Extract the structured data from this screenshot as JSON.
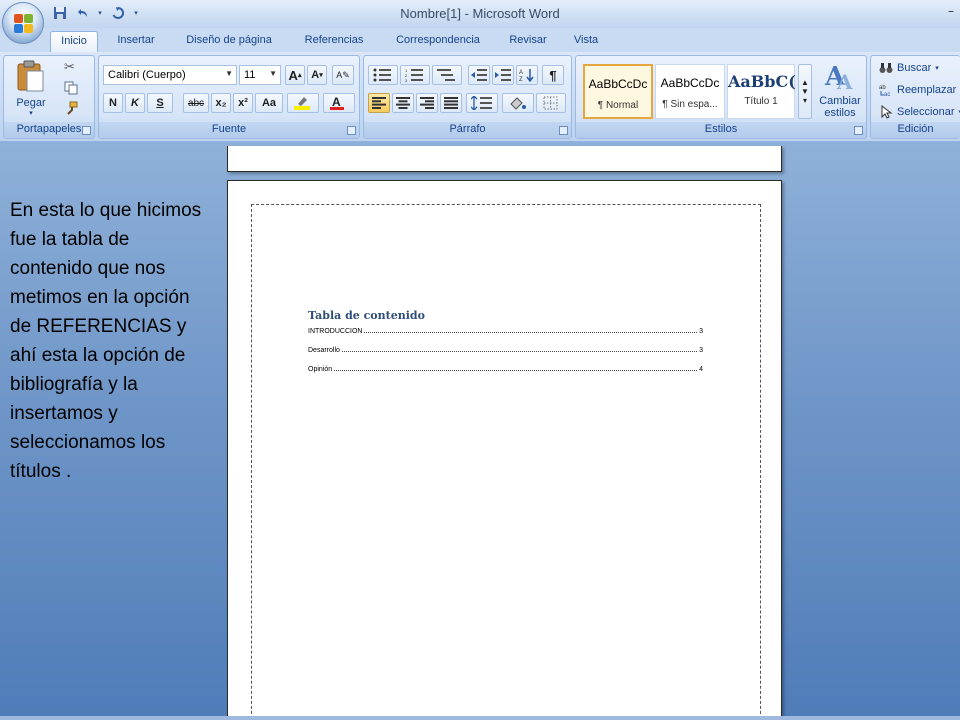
{
  "window": {
    "title": "Nombre[1] - Microsoft Word"
  },
  "tabs": [
    "Inicio",
    "Insertar",
    "Diseño de página",
    "Referencias",
    "Correspondencia",
    "Revisar",
    "Vista"
  ],
  "groups": {
    "clipboard": {
      "label": "Portapapeles",
      "paste": "Pegar"
    },
    "font": {
      "label": "Fuente",
      "font_name": "Calibri (Cuerpo)",
      "font_size": "11",
      "bold": "N",
      "italic": "K",
      "underline": "S",
      "strike": "abc",
      "subscript": "x₂",
      "superscript": "x²",
      "case": "Aa"
    },
    "paragraph": {
      "label": "Párrafo"
    },
    "styles": {
      "label": "Estilos",
      "items": [
        {
          "sample": "AaBbCcDc",
          "name": "¶ Normal"
        },
        {
          "sample": "AaBbCcDc",
          "name": "¶ Sin espa..."
        },
        {
          "sample": "AaBbC(",
          "name": "Título 1"
        }
      ],
      "change_styles": "Cambiar estilos"
    },
    "editing": {
      "label": "Edición",
      "find": "Buscar",
      "replace": "Reemplazar",
      "select": "Seleccionar"
    }
  },
  "caption": "En esta lo que hicimos fue la tabla de contenido  que nos metimos en la opción de REFERENCIAS y ahí esta la opción de bibliografía y la insertamos y seleccionamos los títulos .",
  "document": {
    "toc_title": "Tabla de contenido",
    "toc_entries": [
      {
        "text": "INTRODUCCION",
        "page": "3"
      },
      {
        "text": "Desarrollo",
        "page": "3"
      },
      {
        "text": "Opinión",
        "page": "4"
      }
    ]
  },
  "colors": {
    "accent": "#15428b",
    "ribbon": "#c7dbf3",
    "background": "#6f96c8"
  }
}
